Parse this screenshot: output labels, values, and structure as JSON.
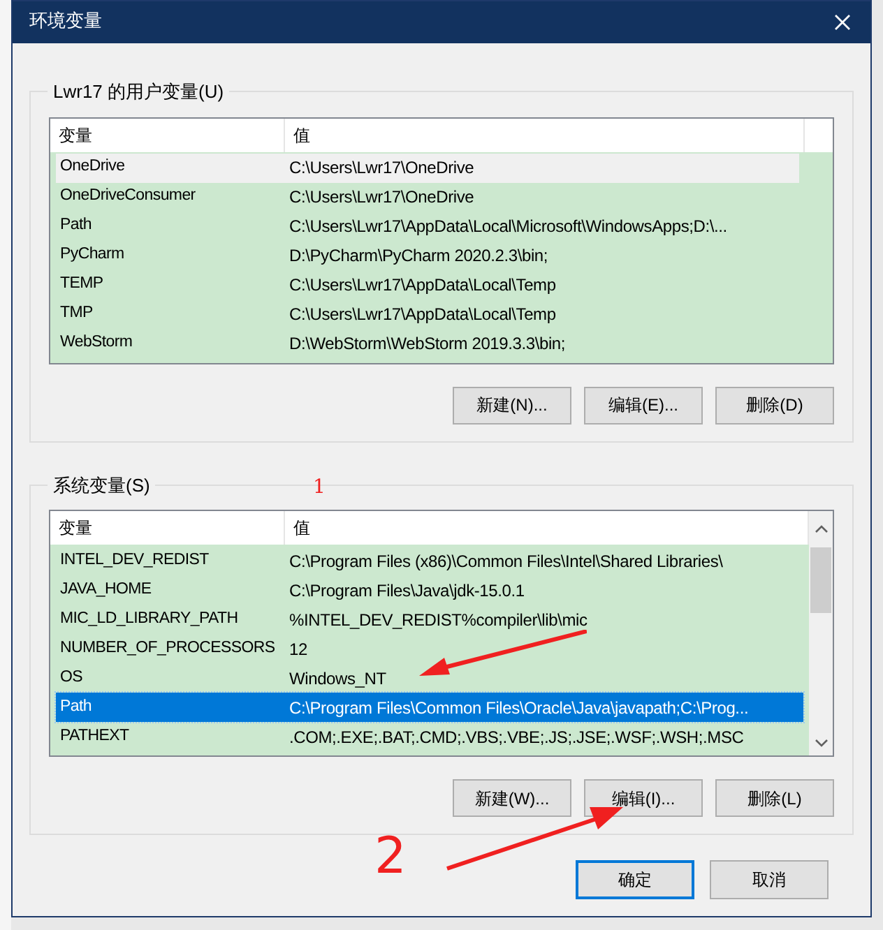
{
  "window": {
    "title": "环境变量"
  },
  "user_variables": {
    "label": "Lwr17 的用户变量(U)",
    "focused": false,
    "columns": [
      "变量",
      "值"
    ],
    "rows": [
      {
        "name": "OneDrive",
        "value": "C:\\Users\\Lwr17\\OneDrive",
        "selected": true
      },
      {
        "name": "OneDriveConsumer",
        "value": "C:\\Users\\Lwr17\\OneDrive",
        "selected": false
      },
      {
        "name": "Path",
        "value": "C:\\Users\\Lwr17\\AppData\\Local\\Microsoft\\WindowsApps;D:\\...",
        "selected": false
      },
      {
        "name": "PyCharm",
        "value": "D:\\PyCharm\\PyCharm 2020.2.3\\bin;",
        "selected": false
      },
      {
        "name": "TEMP",
        "value": "C:\\Users\\Lwr17\\AppData\\Local\\Temp",
        "selected": false
      },
      {
        "name": "TMP",
        "value": "C:\\Users\\Lwr17\\AppData\\Local\\Temp",
        "selected": false
      },
      {
        "name": "WebStorm",
        "value": "D:\\WebStorm\\WebStorm 2019.3.3\\bin;",
        "selected": false
      }
    ],
    "scrollbar": false,
    "buttons": [
      "新建(N)...",
      "编辑(E)...",
      "删除(D)"
    ]
  },
  "system_variables": {
    "label": "系统变量(S)",
    "focused": true,
    "columns": [
      "变量",
      "值"
    ],
    "rows": [
      {
        "name": "INTEL_DEV_REDIST",
        "value": "C:\\Program Files (x86)\\Common Files\\Intel\\Shared Libraries\\",
        "selected": false
      },
      {
        "name": "JAVA_HOME",
        "value": "C:\\Program Files\\Java\\jdk-15.0.1",
        "selected": false
      },
      {
        "name": "MIC_LD_LIBRARY_PATH",
        "value": "%INTEL_DEV_REDIST%compiler\\lib\\mic",
        "selected": false
      },
      {
        "name": "NUMBER_OF_PROCESSORS",
        "value": "12",
        "selected": false
      },
      {
        "name": "OS",
        "value": "Windows_NT",
        "selected": false
      },
      {
        "name": "Path",
        "value": "C:\\Program Files\\Common Files\\Oracle\\Java\\javapath;C:\\Prog...",
        "selected": true
      },
      {
        "name": "PATHEXT",
        "value": ".COM;.EXE;.BAT;.CMD;.VBS;.VBE;.JS;.JSE;.WSF;.WSH;.MSC",
        "selected": false
      }
    ],
    "scrollbar": true,
    "buttons": [
      "新建(W)...",
      "编辑(I)...",
      "删除(L)"
    ]
  },
  "footer_buttons": [
    {
      "label": "确定",
      "default": true
    },
    {
      "label": "取消",
      "default": false
    }
  ],
  "annotations": [
    "1",
    "2"
  ]
}
